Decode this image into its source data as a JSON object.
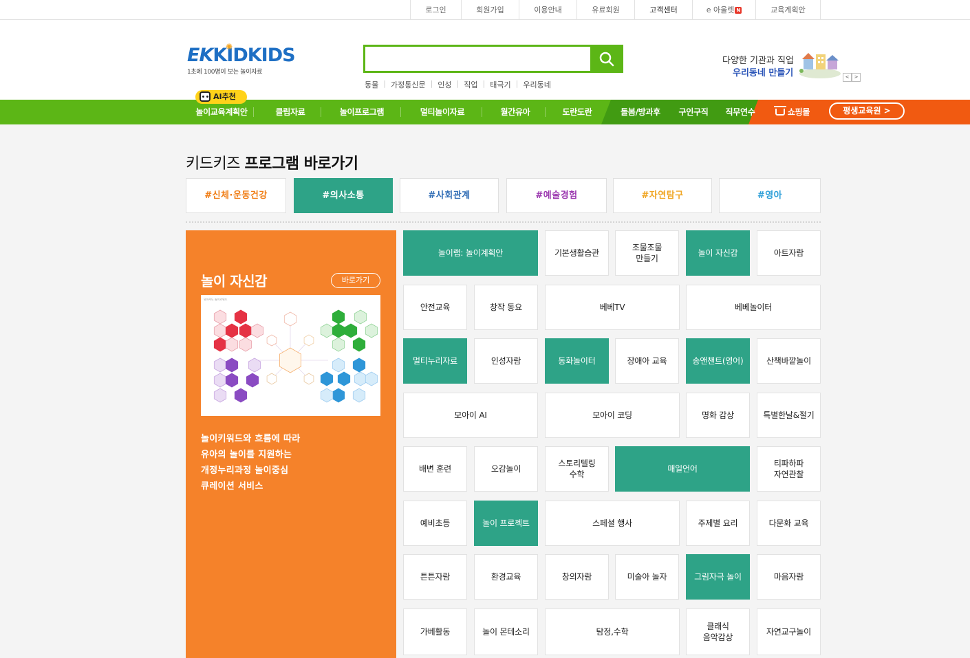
{
  "topbar": {
    "links": [
      "로그인",
      "회원가입",
      "이용안내",
      "유료회원",
      "고객센터",
      "e 아울렛",
      "교육계획안"
    ],
    "new_badge": "N"
  },
  "logo": {
    "brand_ek": "EK",
    "brand_kid": "KIDKIDS",
    "tagline": "1초에 100명이 보는 놀이자료"
  },
  "search": {
    "placeholder": "",
    "value": "",
    "keywords": [
      "동물",
      "가정통신문",
      "인성",
      "직업",
      "태극기",
      "우리동네"
    ]
  },
  "promo": {
    "line1": "다양한 기관과 직업",
    "line2": "우리동네 만들기",
    "prev": "<",
    "next": ">"
  },
  "ai_badge": "AI추천",
  "nav": {
    "items": [
      "놀이교육계획안",
      "클립자료",
      "놀이프로그램",
      "멀티놀이자료",
      "월간유아",
      "도란도란",
      "돌봄/방과후",
      "구인구직",
      "직무연수"
    ],
    "shop": "쇼핑몰",
    "edu": "평생교육원 >"
  },
  "section": {
    "title_prefix": "키드키즈",
    "title_bold": "프로그램 바로가기"
  },
  "tabs": [
    {
      "label": "#신체·운동건강",
      "color": "#f07d14",
      "active": false
    },
    {
      "label": "#의사소통",
      "color": "#2ea387",
      "active": true
    },
    {
      "label": "#사회관계",
      "color": "#2f6cb5",
      "active": false
    },
    {
      "label": "#예술경험",
      "color": "#9c3ab0",
      "active": false
    },
    {
      "label": "#자연탐구",
      "color": "#f0a623",
      "active": false
    },
    {
      "label": "#영아",
      "color": "#2e9fd8",
      "active": false
    }
  ],
  "feature": {
    "title": "놀이 자신감",
    "go_button": "바로가기",
    "description": [
      "놀이키워드와 흐름에 따라",
      "유아의 놀이를 지원하는",
      "개정누리과정 놀이중심",
      "큐레이션 서비스"
    ],
    "image_caption": "유아주도 놀이키워드"
  },
  "programs": [
    {
      "label": "놀이랩: 놀이계획안",
      "teal": true
    },
    {
      "label": "기본생활습관",
      "teal": false
    },
    {
      "label": "조물조물\n만들기",
      "teal": false
    },
    {
      "label": "놀이 자신감",
      "teal": true
    },
    {
      "label": "아트자람",
      "teal": false
    },
    {
      "label": "안전교육",
      "teal": false
    },
    {
      "label": "창작 동요",
      "teal": false
    },
    {
      "label": "베베TV",
      "teal": false
    },
    {
      "label": "베베놀이터",
      "teal": false
    },
    {
      "label": "멀티누리자료",
      "teal": true
    },
    {
      "label": "인성자람",
      "teal": false
    },
    {
      "label": "동화놀이터",
      "teal": true
    },
    {
      "label": "장애아 교육",
      "teal": false
    },
    {
      "label": "송앤챈트(영어)",
      "teal": true
    },
    {
      "label": "산책바깥놀이",
      "teal": false
    },
    {
      "label": "모아이 AI",
      "teal": false
    },
    {
      "label": "모아이 코딩",
      "teal": false
    },
    {
      "label": "명화 감상",
      "teal": false
    },
    {
      "label": "특별한날&절기",
      "teal": false
    },
    {
      "label": "배변 훈련",
      "teal": false
    },
    {
      "label": "오감놀이",
      "teal": false
    },
    {
      "label": "스토리텔링\n수학",
      "teal": false
    },
    {
      "label": "매일언어",
      "teal": true
    },
    {
      "label": "티파하파\n자연관찰",
      "teal": false
    },
    {
      "label": "예비초등",
      "teal": false
    },
    {
      "label": "놀이 프로젝트",
      "teal": true
    },
    {
      "label": "스페셜 행사",
      "teal": false
    },
    {
      "label": "주제별 요리",
      "teal": false
    },
    {
      "label": "다문화 교육",
      "teal": false
    },
    {
      "label": "튼튼자람",
      "teal": false
    },
    {
      "label": "환경교육",
      "teal": false
    },
    {
      "label": "창의자람",
      "teal": false
    },
    {
      "label": "미술아 놀자",
      "teal": false
    },
    {
      "label": "그림자극 놀이",
      "teal": true
    },
    {
      "label": "마음자람",
      "teal": false
    },
    {
      "label": "가베활동",
      "teal": false
    },
    {
      "label": "놀이 몬테소리",
      "teal": false
    },
    {
      "label": "탐정,수학",
      "teal": false
    },
    {
      "label": "클래식\n음악감상",
      "teal": false
    },
    {
      "label": "자연교구놀이",
      "teal": false
    }
  ]
}
